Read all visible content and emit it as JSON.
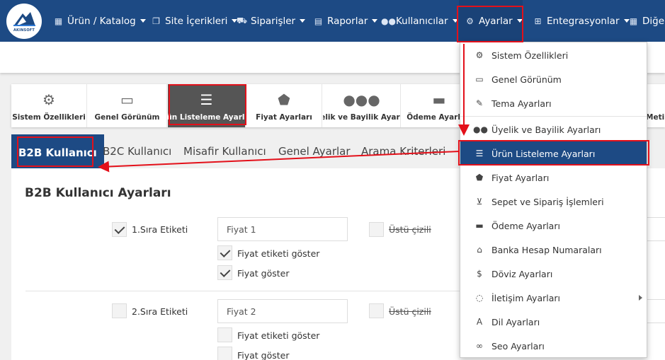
{
  "logo": {
    "text": "AKINSOFT"
  },
  "nav": {
    "items": [
      {
        "label": "Ürün / Katalog",
        "icon": "cubes-icon"
      },
      {
        "label": "Site İçerikleri",
        "icon": "copy-icon"
      },
      {
        "label": "Siparişler",
        "icon": "truck-icon"
      },
      {
        "label": "Raporlar",
        "icon": "file-icon"
      },
      {
        "label": "Kullanıcılar",
        "icon": "users-icon"
      },
      {
        "label": "Ayarlar",
        "icon": "cogs-icon"
      },
      {
        "label": "Entegrasyonlar",
        "icon": "sitemap-icon"
      },
      {
        "label": "Diğer",
        "icon": "th-icon"
      }
    ]
  },
  "tiles": [
    {
      "label": "Sistem Özellikleri",
      "icon": "cogs-icon"
    },
    {
      "label": "Genel Görünüm",
      "icon": "monitor-icon"
    },
    {
      "label": "Ürün Listeleme Ayarları",
      "icon": "list-icon"
    },
    {
      "label": "Fiyat Ayarları",
      "icon": "tags-icon"
    },
    {
      "label": "Üyelik ve Bayilik Ayarları",
      "icon": "users-icon"
    },
    {
      "label": "Ödeme Ayarları",
      "icon": "credit-card-icon"
    },
    {
      "label": "Metin",
      "icon": "text-icon"
    }
  ],
  "subtabs": [
    "B2B Kullanıcı",
    "B2C Kullanıcı",
    "Misafir Kullanıcı",
    "Genel Ayarlar",
    "Arama Kriterleri"
  ],
  "panel": {
    "title": "B2B Kullanıcı Ayarları",
    "rows": [
      {
        "label": "1.Sıra Etiketi",
        "input_value": "Fiyat 1",
        "strike_label": "Üstü çizili",
        "option1": "Fiyat etiketi göster",
        "option2": "Fiyat göster"
      },
      {
        "label": "2.Sıra Etiketi",
        "input_value": "Fiyat 2",
        "strike_label": "Üstü çizili",
        "option1": "Fiyat etiketi göster",
        "option2": "Fiyat göster"
      }
    ]
  },
  "dropdown": {
    "items": [
      {
        "label": "Sistem Özellikleri",
        "icon": "cogs-icon"
      },
      {
        "label": "Genel Görünüm",
        "icon": "monitor-icon"
      },
      {
        "label": "Tema Ayarları",
        "icon": "brush-icon"
      },
      {
        "label": "Üyelik ve Bayilik Ayarları",
        "icon": "users-icon"
      },
      {
        "label": "Ürün Listeleme Ayarları",
        "icon": "list-icon"
      },
      {
        "label": "Fiyat Ayarları",
        "icon": "tags-icon"
      },
      {
        "label": "Sepet ve Sipariş İşlemleri",
        "icon": "basket-icon"
      },
      {
        "label": "Ödeme Ayarları",
        "icon": "credit-card-icon"
      },
      {
        "label": "Banka Hesap Numaraları",
        "icon": "bank-icon"
      },
      {
        "label": "Döviz Ayarları",
        "icon": "dollar-icon"
      },
      {
        "label": "İletişim Ayarları",
        "icon": "comments-icon"
      },
      {
        "label": "Dil Ayarları",
        "icon": "language-icon"
      },
      {
        "label": "Seo Ayarları",
        "icon": "link-icon"
      }
    ]
  },
  "colors": {
    "navbar": "#1d4a84",
    "active_item": "#1d4a84",
    "annotation": "#e3101a",
    "active_tile": "#555555"
  }
}
